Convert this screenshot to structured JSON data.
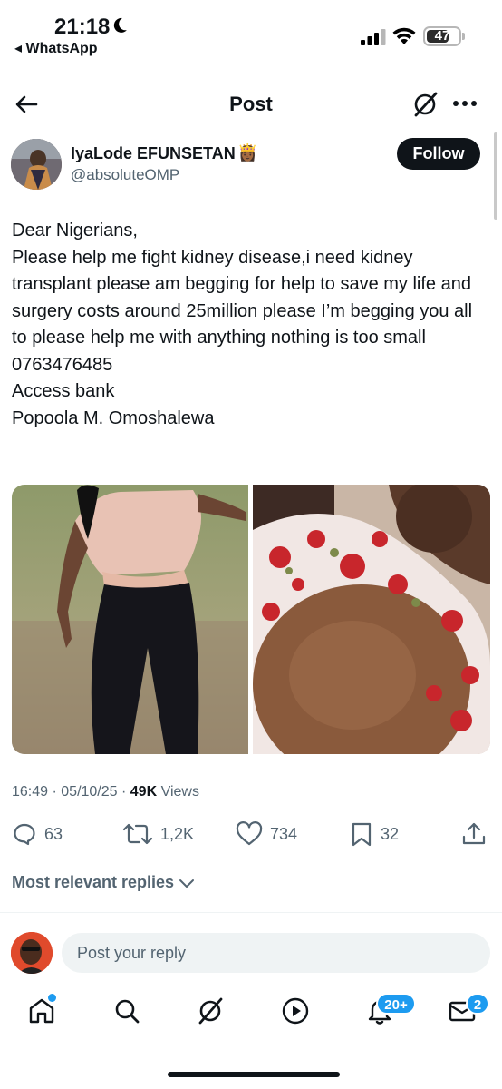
{
  "status_bar": {
    "time": "21:18",
    "back_app": "◂ WhatsApp",
    "battery": "47"
  },
  "header": {
    "title": "Post"
  },
  "author": {
    "display_name": "IyaLode EFUNSETAN",
    "handle": "@absoluteOMP",
    "crown_emoji": "👸🏾",
    "follow_label": "Follow"
  },
  "tweet": {
    "lines": [
      "Dear Nigerians,",
      "Please help me fight kidney disease,i need kidney transplant please am begging for help to save my life and surgery costs around 25million please I’m begging you all to please help me with anything nothing is too small",
      "0763476485",
      "Access bank",
      "Popoola M. Omoshalewa"
    ]
  },
  "meta": {
    "time": "16:49",
    "date": "05/10/25",
    "views_count": "49K",
    "views_label": "Views"
  },
  "actions": {
    "replies": "63",
    "reposts": "1,2K",
    "likes": "734",
    "bookmarks": "32"
  },
  "replies_filter": "Most relevant replies",
  "reply_box": {
    "placeholder": "Post your reply"
  },
  "nav": {
    "notifications_badge": "20+",
    "messages_badge": "2"
  },
  "colors": {
    "text": "#0f1419",
    "secondary": "#536471",
    "accent": "#1d9bf0"
  }
}
